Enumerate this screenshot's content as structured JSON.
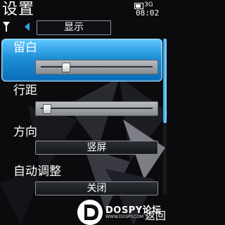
{
  "status": {
    "title": "设置",
    "time": "08:02",
    "signal_mini": "3G"
  },
  "tab": {
    "selected": "显示"
  },
  "settings": [
    {
      "label": "留白",
      "control": "slider",
      "value_fraction": 0.2
    },
    {
      "label": "行距",
      "control": "slider",
      "value_fraction": 0.02
    },
    {
      "label": "方向",
      "control": "select",
      "value": "竖屏"
    },
    {
      "label": "自动调整",
      "control": "select",
      "value": "关闭"
    }
  ],
  "softkeys": {
    "right": "返回"
  },
  "watermark": {
    "brand": "DOSPY论坛",
    "url": "WWW.DOSPY.COM"
  },
  "scroll": {
    "position_fraction": 0.0
  },
  "colors": {
    "accent": "#2aa8e8",
    "highlight": "#1e8fd6"
  },
  "icons": [
    "antenna-icon",
    "battery-icon",
    "left-arrow-icon",
    "dospy-logo-icon"
  ]
}
